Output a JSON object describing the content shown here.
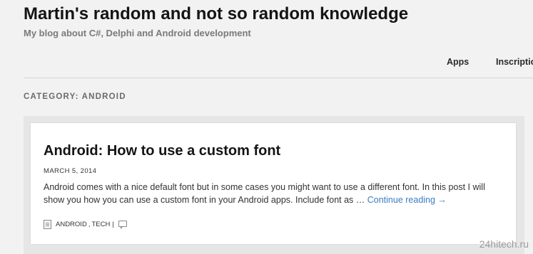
{
  "site": {
    "title": "Martin's random and not so random knowledge",
    "tagline": "My blog about C#, Delphi and Android development"
  },
  "nav": {
    "items": [
      {
        "label": "Apps"
      },
      {
        "label": "Inscriptions"
      }
    ]
  },
  "category": {
    "title": "CATEGORY: ANDROID"
  },
  "post": {
    "title": "Android: How to use a custom font",
    "date": "MARCH 5, 2014",
    "excerpt": "Android comes with a nice default font but in some cases you might want to use a different font. In this post I will show you how you can use a custom font in your Android apps. Include font as … ",
    "read_more": "Continue reading →",
    "categories": [
      "ANDROID",
      "TECH"
    ],
    "icons": {
      "category": "folder-icon",
      "comment": "comment-icon"
    }
  },
  "colors": {
    "link": "#3a7cc4",
    "background": "#f2f2f2",
    "content_area": "#e6e6e6",
    "card": "#ffffff"
  },
  "watermark": "24hitech.ru"
}
